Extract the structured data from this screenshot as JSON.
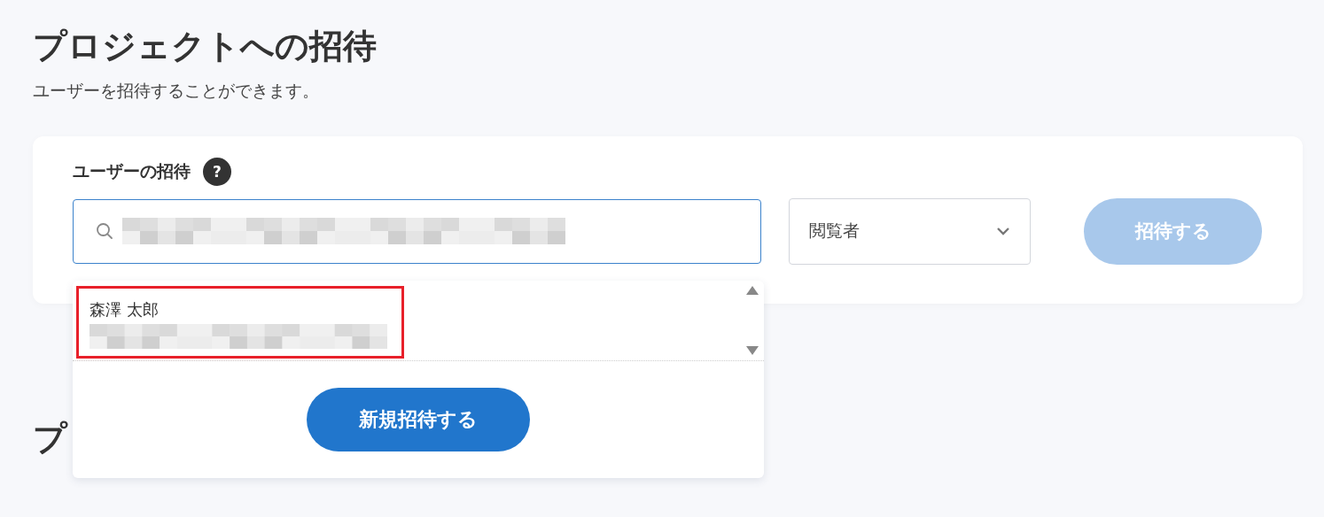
{
  "page": {
    "title": "プロジェクトへの招待",
    "subtitle": "ユーザーを招待することができます。"
  },
  "invite_card": {
    "label": "ユーザーの招待",
    "help_icon": "?",
    "role_select": {
      "value": "閲覧者"
    },
    "invite_button": {
      "label": "招待する",
      "disabled": true
    }
  },
  "suggestions": {
    "options": [
      {
        "name": "森澤 太郎",
        "highlighted": true
      }
    ],
    "new_invite_button": "新規招待する"
  },
  "next_section": {
    "title": "プ"
  }
}
